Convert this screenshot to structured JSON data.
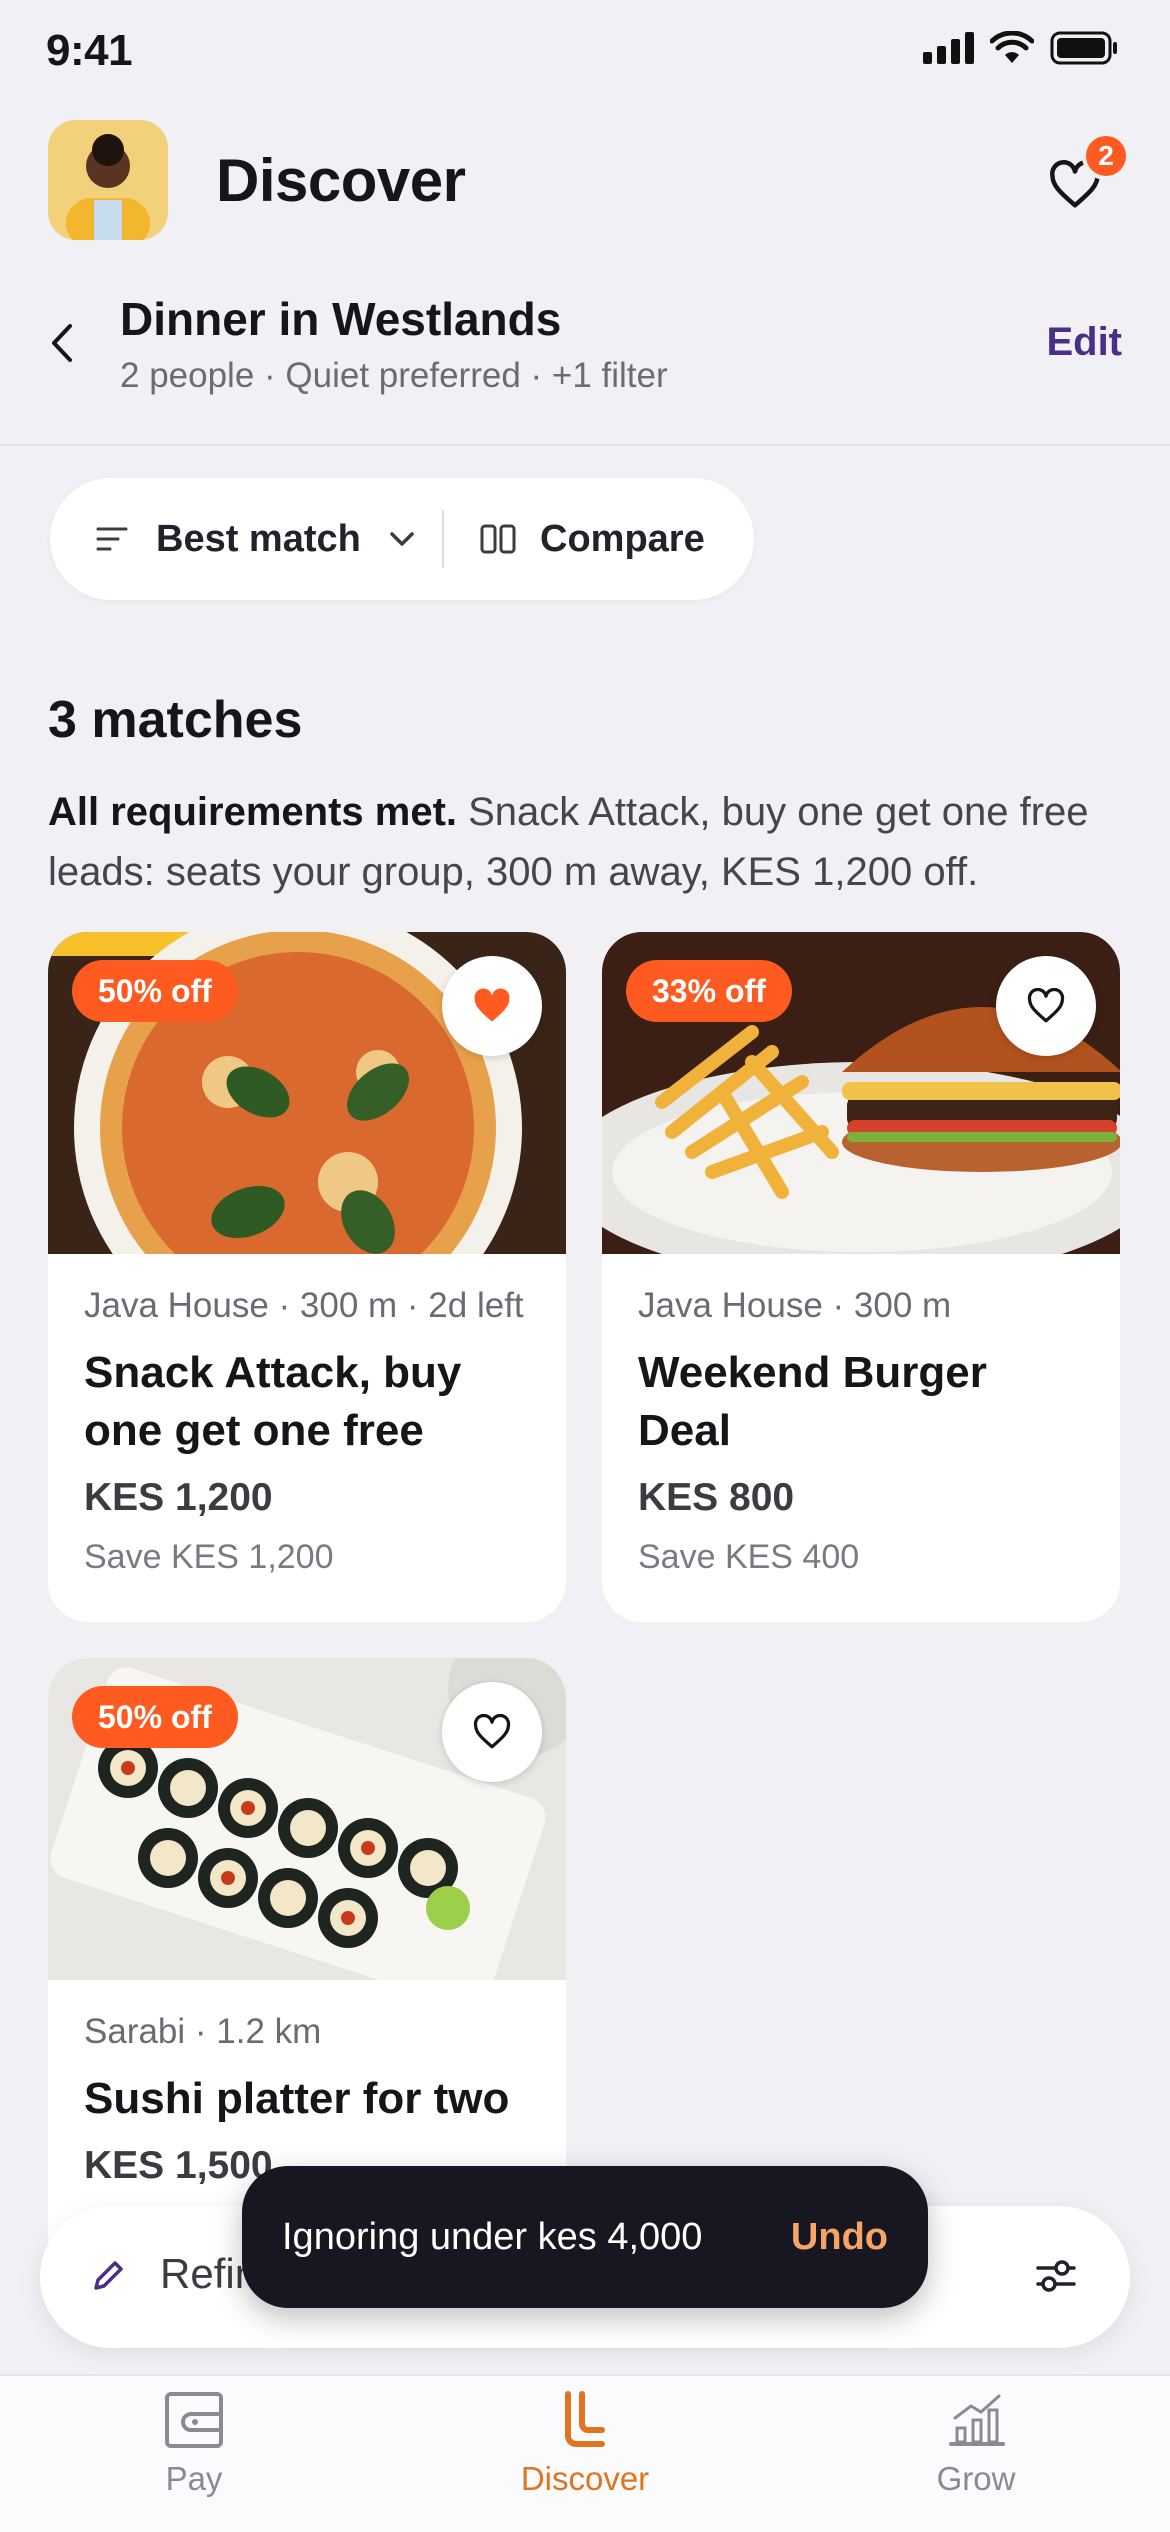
{
  "status": {
    "time": "9:41"
  },
  "header": {
    "title": "Discover",
    "favorites_count": "2"
  },
  "context": {
    "title": "Dinner in Westlands",
    "subtitle": "2 people · Quiet preferred · +1 filter",
    "edit_label": "Edit"
  },
  "toolbar": {
    "sort_label": "Best match",
    "compare_label": "Compare"
  },
  "results": {
    "count_label": "3 matches",
    "summary_bold": "All requirements met.",
    "summary_rest": " Snack Attack, buy one get one free leads: seats your group, 300 m away, KES 1,200 off."
  },
  "deals": [
    {
      "badge": "50% off",
      "meta": "Java House · 300 m · 2d left",
      "name": "Snack Attack, buy one get one free",
      "price": "KES 1,200",
      "save": "Save KES 1,200",
      "favorited": true
    },
    {
      "badge": "33% off",
      "meta": "Java House · 300 m",
      "name": "Weekend Burger Deal",
      "price": "KES 800",
      "save": "Save KES 400",
      "favorited": false
    },
    {
      "badge": "50% off",
      "meta": "Sarabi · 1.2 km",
      "name": "Sushi platter for two",
      "price": "KES 1,500",
      "favorited": false
    }
  ],
  "refine": {
    "label": "Refine"
  },
  "toast": {
    "text": "Ignoring under kes 4,000",
    "action": "Undo"
  },
  "tabs": [
    {
      "label": "Pay",
      "icon": "wallet-icon"
    },
    {
      "label": "Discover",
      "icon": "discover-icon",
      "active": true
    },
    {
      "label": "Grow",
      "icon": "chart-icon"
    }
  ],
  "colors": {
    "accent": "#ff5a1f",
    "brand_purple": "#4b2f86",
    "toast_bg": "#171722",
    "toast_action": "#f6a564",
    "active_tab": "#e0741f"
  }
}
